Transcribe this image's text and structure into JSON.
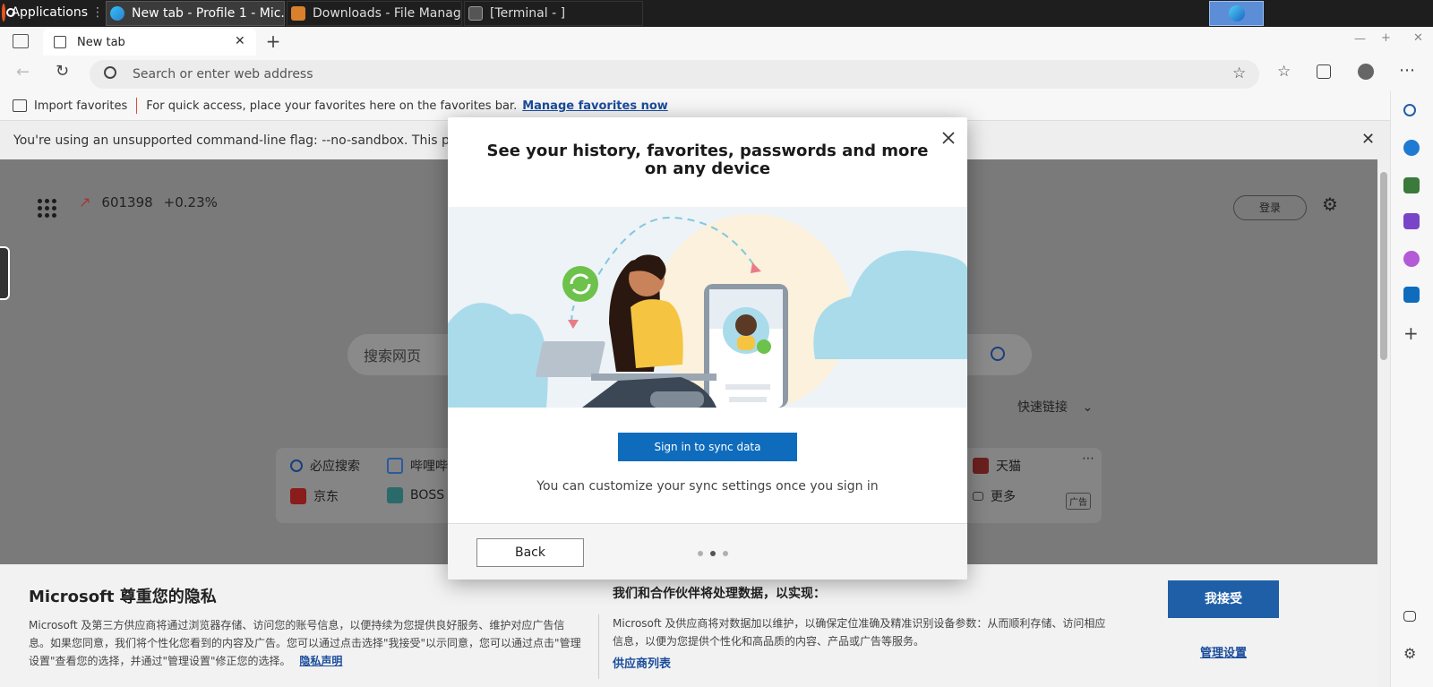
{
  "taskbar": {
    "applications_label": "Applications",
    "tasks": [
      {
        "label": "New tab - Profile 1 - Mic..."
      },
      {
        "label": "Downloads - File Manager"
      },
      {
        "label": "[Terminal - ]"
      }
    ]
  },
  "browser": {
    "tab_title": "New tab",
    "address_placeholder": "Search or enter web address",
    "favbar": {
      "import_label": "Import favorites",
      "hint": "For quick access, place your favorites here on the favorites bar.",
      "manage_link": "Manage favorites now"
    },
    "warning_text": "You're using an unsupported command-line flag: --no-sandbox. This p"
  },
  "newtab": {
    "stock_code": "601398",
    "stock_change": "+0.23%",
    "login_label": "登录",
    "search_placeholder": "搜索网页",
    "quick_links_label": "快速链接",
    "ad_label": "广告",
    "links": [
      {
        "label": "必应搜索"
      },
      {
        "label": "哔哩哔"
      },
      {
        "label": "天猫"
      },
      {
        "label": "京东"
      },
      {
        "label": "BOSS"
      },
      {
        "label": "更多"
      }
    ]
  },
  "modal": {
    "title": "See your history, favorites, passwords and more on any device",
    "sync_button": "Sign in to sync data",
    "subtitle": "You can customize your sync settings once you sign in",
    "back_button": "Back",
    "steps_total": 3,
    "step_active": 2
  },
  "privacy": {
    "title": "Microsoft 尊重您的隐私",
    "body": "Microsoft 及第三方供应商将通过浏览器存储、访问您的账号信息，以便持续为您提供良好服务、维护对应广告信息。如果您同意，我们将个性化您看到的内容及广告。您可以通过点击选择\"我接受\"以示同意，您可以通过点击\"管理设置\"查看您的选择，并通过\"管理设置\"修正您的选择。",
    "privacy_link": "隐私声明",
    "title2": "我们和合作伙伴将处理数据，以实现：",
    "body2": "Microsoft 及供应商将对数据加以维护，以确保定位准确及精准识别设备参数：从而顺利存储、访问相应信息，以便为您提供个性化和高品质的内容、产品或广告等服务。",
    "vendor_link": "供应商列表",
    "accept_button": "我接受",
    "manage_button": "管理设置"
  },
  "colors": {
    "accent": "#0f6cbd",
    "privacy_accept": "#1f5fa8",
    "stock_up": "#d9443a"
  }
}
